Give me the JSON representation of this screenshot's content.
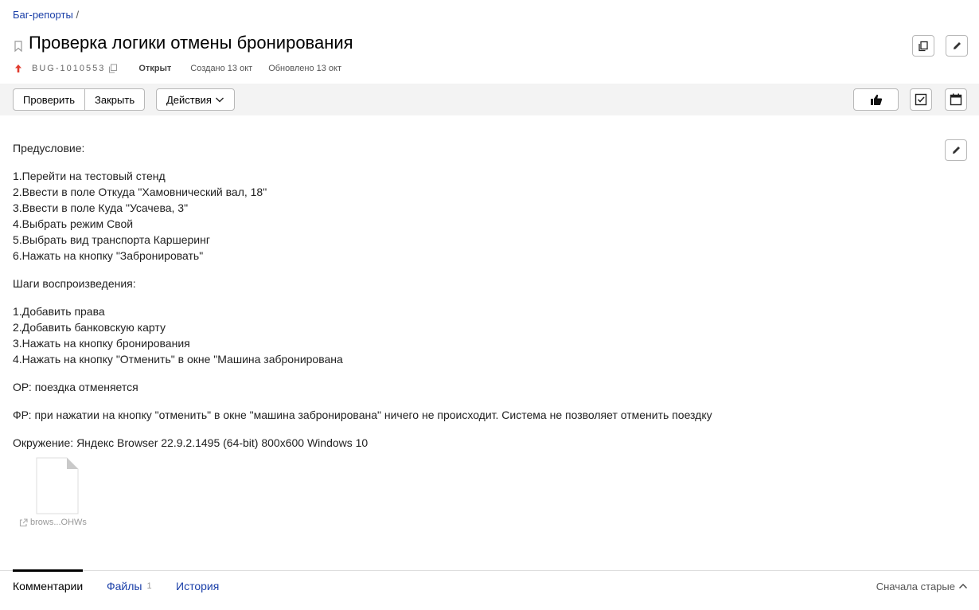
{
  "breadcrumb": {
    "link": "Баг-репорты",
    "separator": "/"
  },
  "issue": {
    "title": "Проверка логики отмены бронирования",
    "key": "BUG-1010553",
    "status": "Открыт",
    "created": "Создано 13 окт",
    "updated": "Обновлено 13 окт",
    "priority_color": "#e03b2e"
  },
  "toolbar": {
    "check_label": "Проверить",
    "close_label": "Закрыть",
    "actions_label": "Действия"
  },
  "description": {
    "precondition_header": "Предусловие:",
    "precondition_steps": [
      "1.Перейти на тестовый стенд",
      "2.Ввести в поле Откуда \"Хамовнический вал, 18\"",
      "3.Ввести в поле Куда \"Усачева, 3\"",
      "4.Выбрать режим Свой",
      "5.Выбрать вид транспорта Каршеринг",
      "6.Нажать на кнопку \"Забронировать\""
    ],
    "steps_header": "Шаги воспроизведения:",
    "steps": [
      "1.Добавить права",
      "2.Добавить банковскую карту",
      "3.Нажать на кнопку бронирования",
      "4.Нажать на кнопку \"Отменить\" в окне \"Машина забронирована"
    ],
    "expected": "ОР: поездка отменяется",
    "actual": "ФР: при нажатии на кнопку \"отменить\" в окне \"машина забронирована\" ничего не происходит. Система не позволяет отменить поездку",
    "environment": "Окружение: Яндекс Browser 22.9.2.1495 (64-bit) 800х600 Windows 10"
  },
  "attachment": {
    "name": "brows...OHWs",
    "icon": "external-link-icon"
  },
  "tabs": {
    "comments": "Комментарии",
    "files": "Файлы",
    "files_count": "1",
    "history": "История",
    "sort_label": "Сначала старые"
  },
  "colors": {
    "link": "#1a3fa8",
    "toolbar_bg": "#f3f3f3"
  }
}
